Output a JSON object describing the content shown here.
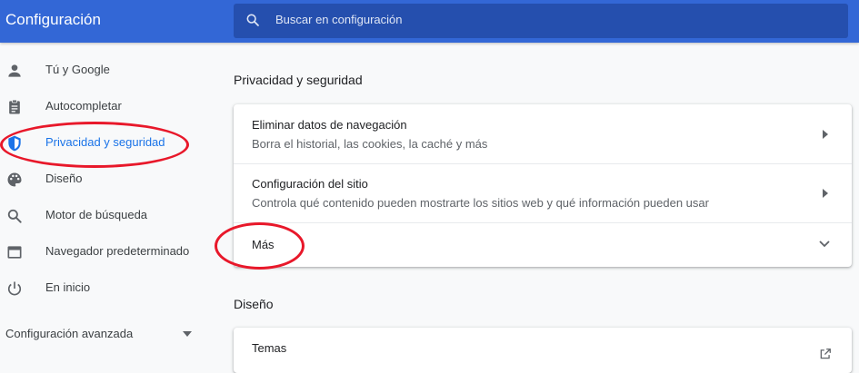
{
  "header": {
    "title": "Configuración",
    "search_placeholder": "Buscar en configuración"
  },
  "sidebar": {
    "items": [
      {
        "label": "Tú y Google",
        "icon": "person-icon"
      },
      {
        "label": "Autocompletar",
        "icon": "clipboard-icon"
      },
      {
        "label": "Privacidad y seguridad",
        "icon": "shield-icon",
        "active": true
      },
      {
        "label": "Diseño",
        "icon": "palette-icon"
      },
      {
        "label": "Motor de búsqueda",
        "icon": "search-icon"
      },
      {
        "label": "Navegador predeterminado",
        "icon": "browser-window-icon"
      },
      {
        "label": "En inicio",
        "icon": "power-icon"
      }
    ],
    "advanced_label": "Configuración avanzada"
  },
  "main": {
    "privacy_section_title": "Privacidad y seguridad",
    "privacy_rows": [
      {
        "title": "Eliminar datos de navegación",
        "subtitle": "Borra el historial, las cookies, la caché y más"
      },
      {
        "title": "Configuración del sitio",
        "subtitle": "Controla qué contenido pueden mostrarte los sitios web y qué información pueden usar"
      },
      {
        "title": "Más"
      }
    ],
    "design_section_title": "Diseño",
    "design_rows": [
      {
        "title": "Temas"
      }
    ]
  },
  "colors": {
    "header_blue": "#3367d6",
    "active_blue": "#1a73e8",
    "annotation_red": "#e8182a"
  }
}
